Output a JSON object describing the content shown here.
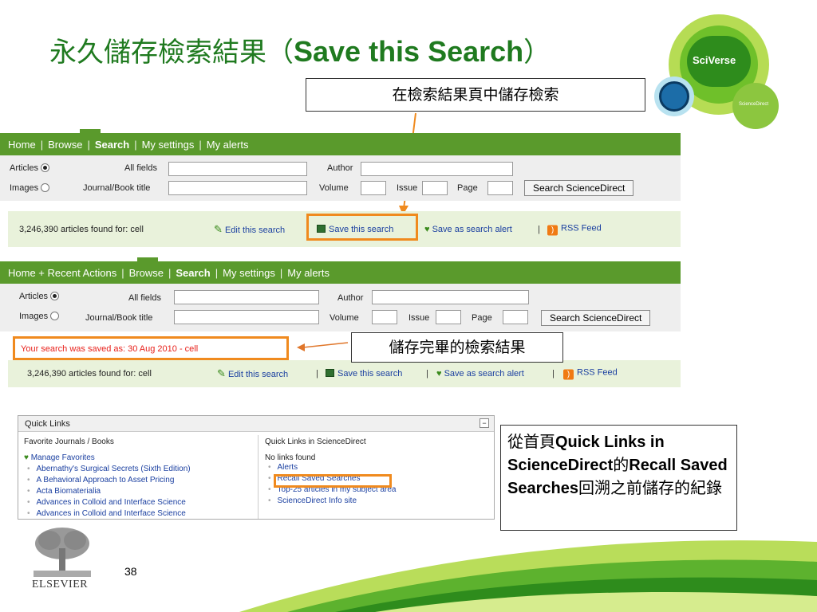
{
  "slide": {
    "title_zh": "永久儲存檢索結果（",
    "title_en": "Save this Search",
    "title_close": "）",
    "page_number": "38"
  },
  "logo": {
    "sciverse": "SciVerse",
    "sciencedirect": "ScienceDirect",
    "elsevier": "ELSEVIER"
  },
  "callouts": {
    "top": "在檢索結果頁中儲存檢索",
    "middle": "儲存完畢的檢索結果",
    "bottom_parts": [
      "從首頁",
      "Quick Links in ScienceDirect",
      "的",
      "Recall Saved Searches",
      "回溯之前儲存的紀錄"
    ]
  },
  "screen1": {
    "nav": {
      "home": "Home",
      "browse": "Browse",
      "search": "Search",
      "settings": "My settings",
      "alerts": "My alerts"
    },
    "form": {
      "articles": "Articles",
      "images": "Images",
      "all_fields": "All fields",
      "journal_title": "Journal/Book title",
      "author": "Author",
      "volume": "Volume",
      "issue": "Issue",
      "page": "Page",
      "search_button": "Search ScienceDirect"
    },
    "results": {
      "count": "3,246,390 articles found for: cell",
      "edit": "Edit this search",
      "save": "Save this search",
      "alert": "Save as search alert",
      "rss": "RSS Feed"
    }
  },
  "screen2": {
    "nav": {
      "home": "Home + Recent Actions",
      "browse": "Browse",
      "search": "Search",
      "settings": "My settings",
      "alerts": "My alerts"
    },
    "form": {
      "articles": "Articles",
      "images": "Images",
      "all_fields": "All fields",
      "journal_title": "Journal/Book title",
      "author": "Author",
      "volume": "Volume",
      "issue": "Issue",
      "page": "Page",
      "search_button": "Search ScienceDirect"
    },
    "saved_message": "Your search was saved as:  30 Aug 2010 - cell",
    "results": {
      "count": "3,246,390 articles found for: cell",
      "edit": "Edit this search",
      "save": "Save this search",
      "alert": "Save as search alert",
      "rss": "RSS Feed"
    }
  },
  "quick_links": {
    "header": "Quick Links",
    "left_heading": "Favorite Journals / Books",
    "manage": "Manage Favorites",
    "journals": [
      "Abernathy's Surgical Secrets (Sixth Edition)",
      "A Behavioral Approach to Asset Pricing",
      "Acta Biomaterialia",
      "Advances in Colloid and Interface Science",
      "Advances in Colloid and Interface Science"
    ],
    "right_heading": "Quick Links in ScienceDirect",
    "no_links": "No links found",
    "links": [
      "Alerts",
      "Recall Saved Searches",
      "Top-25 articles in my subject area",
      "ScienceDirect Info site"
    ]
  },
  "colors": {
    "green_bar": "#5a9a2c",
    "orange": "#f08a1e",
    "title_green": "#1f7a1f"
  }
}
